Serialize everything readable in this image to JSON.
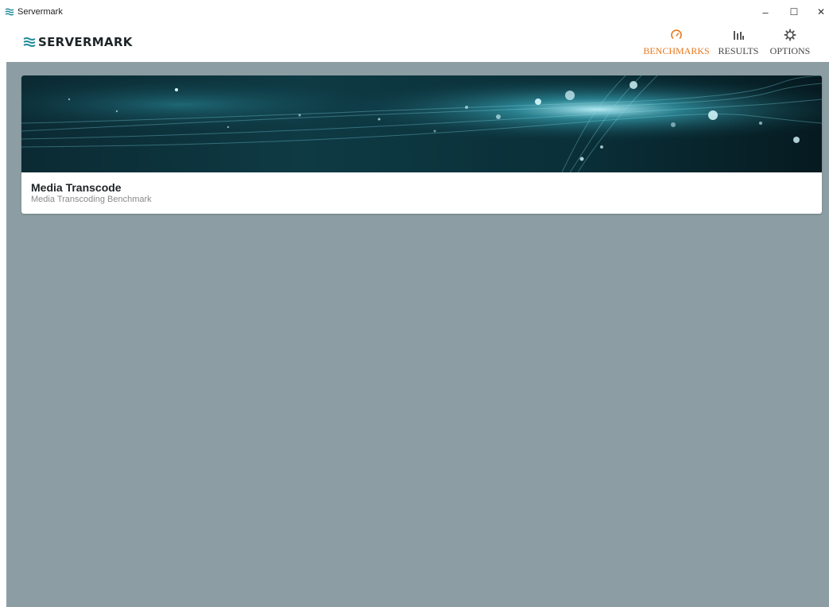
{
  "window": {
    "title": "Servermark",
    "minimize_glyph": "–",
    "maximize_glyph": "☐",
    "close_glyph": "✕"
  },
  "header": {
    "logo_text": "SERVERMARK",
    "nav": [
      {
        "label": "BENCHMARKS",
        "icon": "gauge-icon",
        "active": true
      },
      {
        "label": "RESULTS",
        "icon": "bar-chart-icon",
        "active": false
      },
      {
        "label": "OPTIONS",
        "icon": "gear-icon",
        "active": false
      }
    ]
  },
  "benchmarks": [
    {
      "title": "Media Transcode",
      "subtitle": "Media Transcoding Benchmark"
    }
  ],
  "colors": {
    "accent": "#e8771d",
    "brand_teal": "#1f8a9a",
    "content_bg": "#8c9ea3"
  }
}
